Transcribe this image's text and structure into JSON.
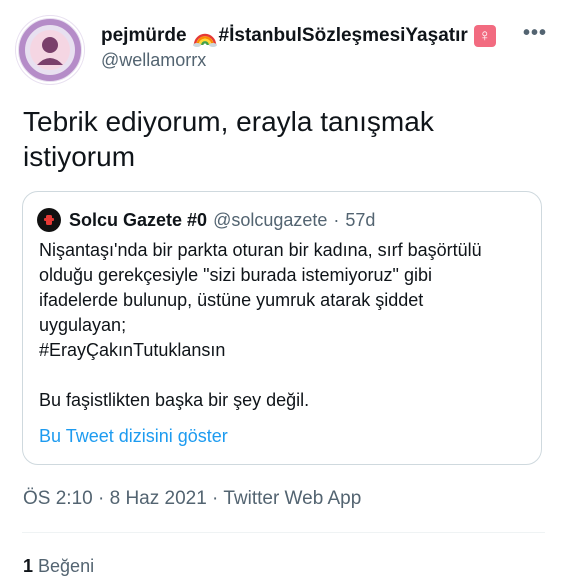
{
  "author": {
    "name": "pejmürde",
    "name_tag": "#İstanbulSözleşmesiYaşatır",
    "handle": "@wellamorrx",
    "icons": [
      "rainbow-icon",
      "female-sign-icon"
    ],
    "female_sign": "♀"
  },
  "more_label": "•••",
  "tweet": {
    "text": "Tebrik ediyorum, erayla tanışmak istiyorum"
  },
  "quoted": {
    "name": "Solcu Gazete #0",
    "handle": "@solcugazete",
    "separator": "·",
    "age": "57d",
    "lines": [
      "Nişantaşı'nda bir parkta oturan bir kadına, sırf başörtülü",
      "olduğu gerekçesiyle \"sizi burada istemiyoruz\" gibi",
      "ifadelerde bulunup, üstüne yumruk atarak şiddet",
      "uygulayan;",
      "#ErayÇakınTutuklansın",
      "",
      "Bu faşistlikten başka bir şey değil."
    ],
    "show_thread": "Bu Tweet dizisini göster"
  },
  "timestamp": "ÖS 2:10 · 8 Haz 2021 · Twitter Web App",
  "likes": {
    "count": "1",
    "label": "Beğeni"
  },
  "colors": {
    "link": "#1d9bf0",
    "secondary": "#536471",
    "border": "#cfd9de",
    "badge": "#f26b80"
  }
}
